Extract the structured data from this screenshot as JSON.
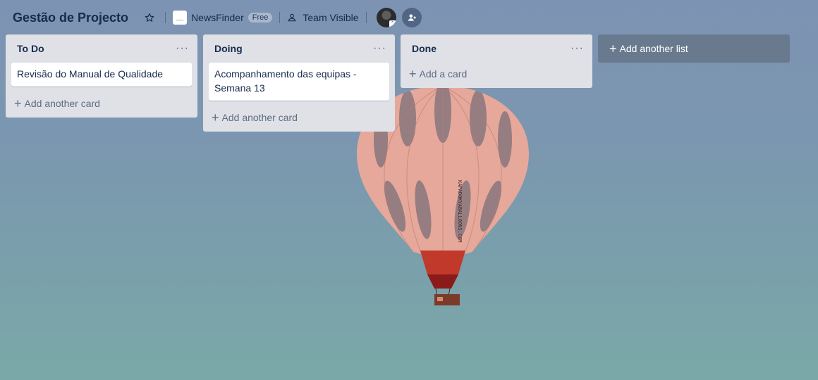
{
  "board": {
    "title": "Gestão de Projecto",
    "workspace_name": "NewsFinder",
    "workspace_badge": "Free",
    "visibility": "Team Visible"
  },
  "icons": {
    "star": "star-icon",
    "visibility": "team-icon",
    "invite": "add-member-icon",
    "menu": "ellipsis-icon",
    "plus": "plus-icon"
  },
  "lists": [
    {
      "title": "To Do",
      "cards": [
        "Revisão do Manual de Qualidade"
      ],
      "add_label": "Add another card"
    },
    {
      "title": "Doing",
      "cards": [
        "Acompanhamento das equipas - Semana 13"
      ],
      "add_label": "Add another card"
    },
    {
      "title": "Done",
      "cards": [],
      "add_label": "Add a card"
    }
  ],
  "add_list_label": "Add another list",
  "menu_glyph": "···",
  "plus_glyph": "+",
  "balloon_lettering": "KAPADOKYABALLOONS.COM",
  "colors": {
    "list_bg": "#dfe1e6",
    "card_bg": "#ffffff",
    "text": "#172b4d",
    "muted": "#5e6c84"
  }
}
